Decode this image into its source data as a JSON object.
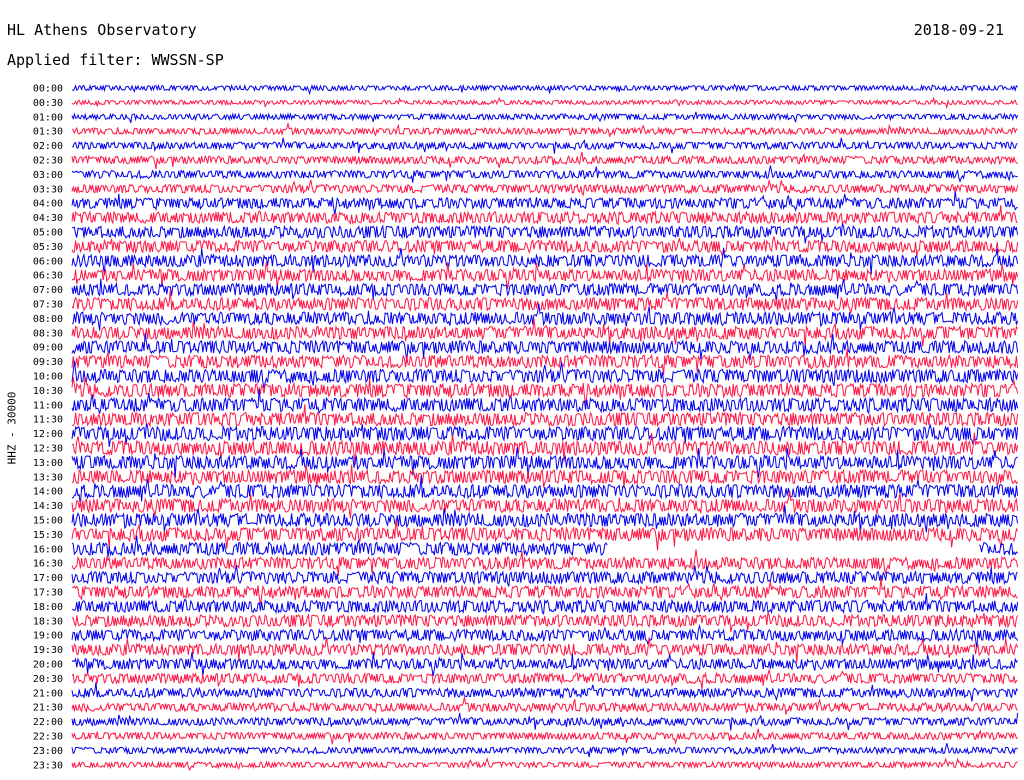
{
  "header": {
    "station": "HL Athens Observatory",
    "date": "2018-09-21",
    "filter": "Applied filter: WWSSN-SP"
  },
  "channel_label": "HHZ - 30000",
  "colors": {
    "odd_trace": "#0000ee",
    "even_trace": "#ff1744",
    "background": "#ffffff"
  },
  "chart_data": {
    "type": "line",
    "title": "HL Athens Observatory",
    "subtitle": "Applied filter: WWSSN-SP",
    "date": "2018-09-21",
    "ylabel": "HHZ - 30000",
    "xlabel": "",
    "legend": "none",
    "grid": false,
    "row_interval_minutes": 30,
    "rows": [
      "00:00",
      "00:30",
      "01:00",
      "01:30",
      "02:00",
      "02:30",
      "03:00",
      "03:30",
      "04:00",
      "04:30",
      "05:00",
      "05:30",
      "06:00",
      "06:30",
      "07:00",
      "07:30",
      "08:00",
      "08:30",
      "09:00",
      "09:30",
      "10:00",
      "10:30",
      "11:00",
      "11:30",
      "12:00",
      "12:30",
      "13:00",
      "13:30",
      "14:00",
      "14:30",
      "15:00",
      "15:30",
      "16:00",
      "16:30",
      "17:00",
      "17:30",
      "18:00",
      "18:30",
      "19:00",
      "19:30",
      "20:00",
      "20:30",
      "21:00",
      "21:30",
      "22:00",
      "22:30",
      "23:00",
      "23:30"
    ],
    "trace_colors": [
      "#0000ee",
      "#ff1744"
    ],
    "relative_noise_amplitude": [
      0.35,
      0.3,
      0.4,
      0.45,
      0.5,
      0.55,
      0.55,
      0.6,
      0.75,
      0.8,
      0.85,
      0.85,
      0.85,
      0.85,
      0.85,
      0.9,
      0.9,
      0.9,
      0.9,
      0.9,
      0.95,
      0.95,
      0.95,
      0.95,
      1.0,
      1.0,
      0.95,
      0.95,
      0.95,
      0.95,
      0.95,
      0.95,
      0.9,
      0.85,
      0.85,
      0.85,
      0.85,
      0.85,
      0.8,
      0.8,
      0.75,
      0.7,
      0.65,
      0.6,
      0.55,
      0.5,
      0.45,
      0.4
    ],
    "data_gap": {
      "row": "16:00",
      "from_fraction": 0.567,
      "to_fraction": 0.958
    }
  }
}
